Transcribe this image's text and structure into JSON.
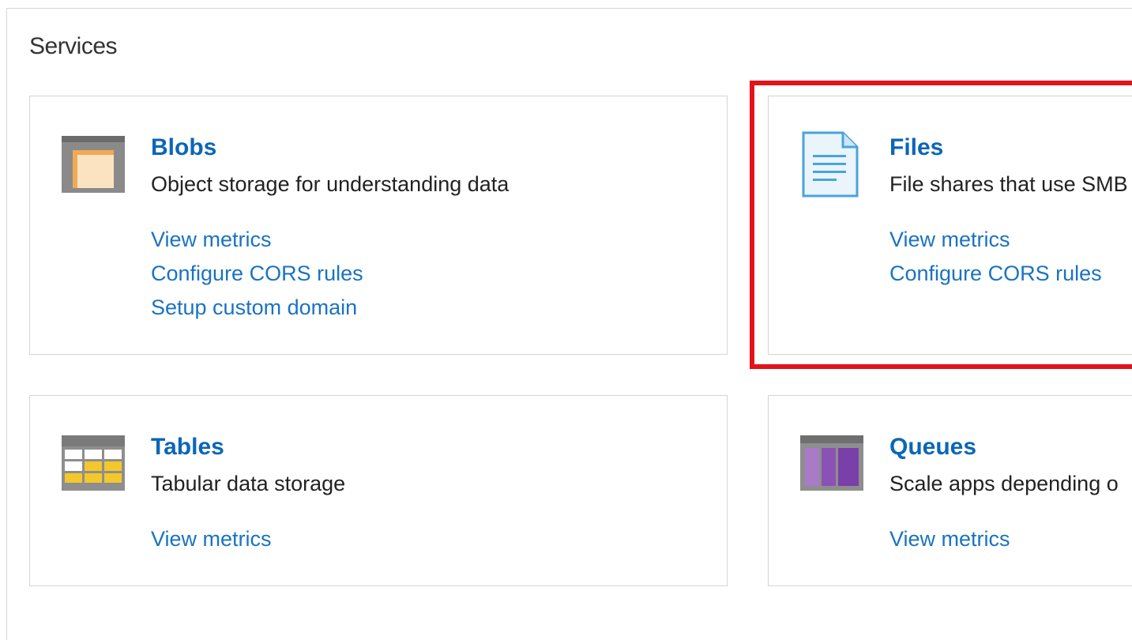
{
  "section": {
    "title": "Services"
  },
  "cards": {
    "blobs": {
      "icon": "blob-storage-icon",
      "title": "Blobs",
      "description": "Object storage for understanding data",
      "links": [
        "View metrics",
        "Configure CORS rules",
        "Setup custom domain"
      ]
    },
    "files": {
      "icon": "file-share-icon",
      "title": "Files",
      "description": "File shares that use SMB",
      "links": [
        "View metrics",
        "Configure CORS rules"
      ]
    },
    "tables": {
      "icon": "table-storage-icon",
      "title": "Tables",
      "description": "Tabular data storage",
      "links": [
        "View metrics"
      ]
    },
    "queues": {
      "icon": "queue-storage-icon",
      "title": "Queues",
      "description": "Scale apps depending o",
      "links": [
        "View metrics"
      ]
    }
  },
  "colors": {
    "link": "#1a73c1",
    "title": "#0b66b7",
    "highlight": "#e3121b"
  }
}
